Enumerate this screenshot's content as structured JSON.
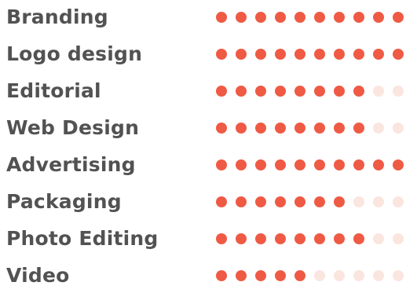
{
  "colors": {
    "label": "#525252",
    "dot_filled": "#ef5a45",
    "dot_empty": "#fbe5df"
  },
  "max_rating": 10,
  "skills": [
    {
      "label": "Branding",
      "rating": 10
    },
    {
      "label": "Logo design",
      "rating": 10
    },
    {
      "label": "Editorial",
      "rating": 8
    },
    {
      "label": "Web Design",
      "rating": 8
    },
    {
      "label": "Advertising",
      "rating": 10
    },
    {
      "label": "Packaging",
      "rating": 7
    },
    {
      "label": "Photo Editing",
      "rating": 8
    },
    {
      "label": "Video",
      "rating": 5
    }
  ]
}
